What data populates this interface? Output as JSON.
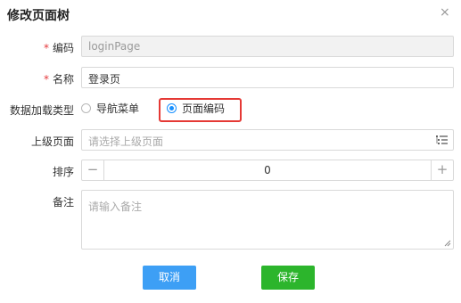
{
  "dialog": {
    "title": "修改页面树",
    "close_glyph": "×"
  },
  "form": {
    "code": {
      "label": "编码",
      "required_mark": "*",
      "value": "loginPage",
      "disabled": true
    },
    "name": {
      "label": "名称",
      "required_mark": "*",
      "value": "登录页"
    },
    "load_type": {
      "label": "数据加载类型",
      "options": [
        {
          "label": "导航菜单",
          "selected": false
        },
        {
          "label": "页面编码",
          "selected": true
        }
      ]
    },
    "parent": {
      "label": "上级页面",
      "placeholder": "请选择上级页面"
    },
    "order": {
      "label": "排序",
      "value": "0",
      "minus": "−",
      "plus": "+"
    },
    "remark": {
      "label": "备注",
      "placeholder": "请输入备注"
    }
  },
  "buttons": {
    "cancel": "取消",
    "save": "保存"
  },
  "colors": {
    "required": "#e4393c",
    "primary": "#3d9ff5",
    "success": "#2cb52c",
    "radio_accent": "#1890ff",
    "highlight": "#e53935"
  }
}
